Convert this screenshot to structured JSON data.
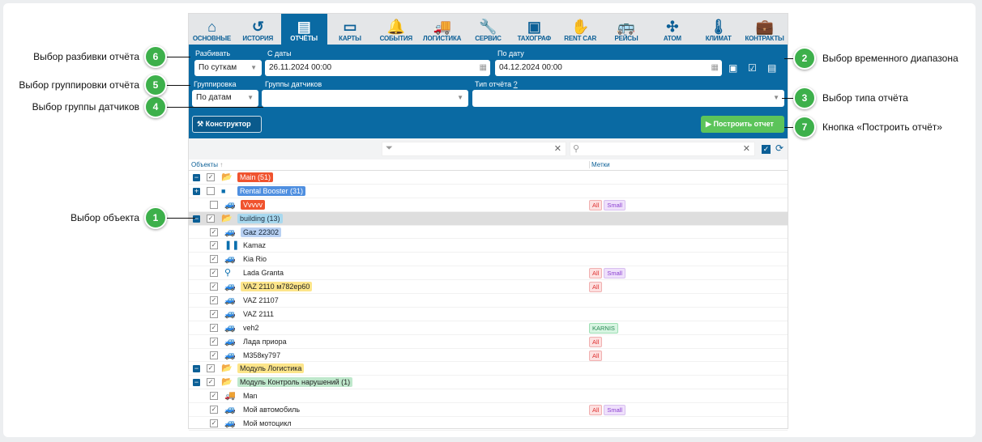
{
  "nav": [
    {
      "label": "ОСНОВНЫЕ",
      "icon": "home-icon",
      "g": "⌂"
    },
    {
      "label": "ИСТОРИЯ",
      "icon": "history-icon",
      "g": "↺"
    },
    {
      "label": "ОТЧЁТЫ",
      "icon": "document-icon",
      "g": "▤",
      "active": true
    },
    {
      "label": "КАРТЫ",
      "icon": "card-icon",
      "g": "▭"
    },
    {
      "label": "СОБЫТИЯ",
      "icon": "bell-icon",
      "g": "🔔"
    },
    {
      "label": "ЛОГИСТИКА",
      "icon": "truck-icon",
      "g": "🚚"
    },
    {
      "label": "СЕРВИС",
      "icon": "wrench-icon",
      "g": "🔧"
    },
    {
      "label": "ТАХОГРАФ",
      "icon": "id-card-icon",
      "g": "▣"
    },
    {
      "label": "RENT CAR",
      "icon": "handshake-icon",
      "g": "✋"
    },
    {
      "label": "РЕЙСЫ",
      "icon": "bus-icon",
      "g": "🚌"
    },
    {
      "label": "ATOM",
      "icon": "network-icon",
      "g": "✣"
    },
    {
      "label": "КЛИМАТ",
      "icon": "thermometer-icon",
      "g": "🌡"
    },
    {
      "label": "КОНТРАКТЫ",
      "icon": "briefcase-icon",
      "g": "💼"
    }
  ],
  "form": {
    "split_label": "Разбивать",
    "split_value": "По суткам",
    "from_label": "С даты",
    "from_value": "26.11.2024 00:00",
    "to_label": "По дату",
    "to_value": "04.12.2024 00:00",
    "group_label": "Группировка",
    "group_value": "По датам",
    "sensors_label": "Группы датчиков",
    "sensors_value": "",
    "type_label": "Тип отчёта",
    "type_help": "?",
    "type_value": "",
    "constructor": "Конструктор",
    "build": "Построить отчет"
  },
  "table": {
    "col_objects": "Объекты",
    "col_tags": "Метки"
  },
  "rows": [
    {
      "level": 0,
      "expand": "−",
      "checked": true,
      "icon": "folder-open-icon",
      "name": "Main (51)",
      "bg": "#f0532e",
      "fg": "#fff"
    },
    {
      "level": 0,
      "expand": "+",
      "checked": false,
      "icon": "folder-icon",
      "name": "Rental Booster (31)",
      "bg": "#4f8fe0",
      "fg": "#fff"
    },
    {
      "level": 1,
      "checked": false,
      "icon": "car-icon",
      "name": "Vvvvv",
      "bg": "#f0532e",
      "fg": "#fff",
      "tags": [
        "All",
        "Small"
      ]
    },
    {
      "level": 0,
      "expand": "−",
      "checked": true,
      "icon": "folder-open-icon",
      "name": "building (13)",
      "bg": "#a8d8ee",
      "fg": "#234",
      "sel": true
    },
    {
      "level": 1,
      "checked": true,
      "icon": "car-icon",
      "name": "Gaz 22302",
      "bg": "#b8d0f2",
      "fg": "#123"
    },
    {
      "level": 1,
      "checked": true,
      "icon": "footprints-icon",
      "name": "Kamaz"
    },
    {
      "level": 1,
      "checked": true,
      "icon": "car-icon",
      "name": "Kia Rio"
    },
    {
      "level": 1,
      "checked": true,
      "icon": "map-pin-icon",
      "name": "Lada Granta",
      "tags": [
        "All",
        "Small"
      ]
    },
    {
      "level": 1,
      "checked": true,
      "icon": "car-icon",
      "name": "VAZ 2110 м782ер60",
      "bg": "#fde58a",
      "fg": "#222",
      "tags": [
        "All"
      ]
    },
    {
      "level": 1,
      "checked": true,
      "icon": "car-icon",
      "name": "VAZ 21107"
    },
    {
      "level": 1,
      "checked": true,
      "icon": "car-icon",
      "name": "VAZ 2111"
    },
    {
      "level": 1,
      "checked": true,
      "icon": "car-icon",
      "name": "veh2",
      "tags": [
        "KARNIS"
      ]
    },
    {
      "level": 1,
      "checked": true,
      "icon": "car-icon",
      "name": "Лада приора",
      "tags": [
        "All"
      ]
    },
    {
      "level": 1,
      "checked": true,
      "icon": "car-icon",
      "name": "М358ку797",
      "tags": [
        "All"
      ]
    },
    {
      "level": 0,
      "expand": "−",
      "checked": true,
      "icon": "folder-open-icon",
      "name": "Модуль Логистика",
      "bg": "#fde58a",
      "fg": "#222"
    },
    {
      "level": 0,
      "expand": "−",
      "checked": true,
      "icon": "folder-open-icon",
      "name": "Модуль Контроль нарушений (1)",
      "bg": "#bfe8cc",
      "fg": "#222"
    },
    {
      "level": 1,
      "checked": true,
      "icon": "truck-icon",
      "name": "Man"
    },
    {
      "level": 1,
      "checked": true,
      "icon": "car-icon",
      "name": "Мой автомобиль",
      "tags": [
        "All",
        "Small"
      ]
    },
    {
      "level": 1,
      "checked": true,
      "icon": "car-icon",
      "name": "Мой мотоцикл"
    }
  ],
  "tag_colors": {
    "All": [
      "#fde0e0",
      "#f0b0b0",
      "#d33"
    ],
    "Small": [
      "#efe0fb",
      "#d8c0f0",
      "#8a3fd0"
    ],
    "KARNIS": [
      "#d8f5e2",
      "#9edfb4",
      "#2a8a55"
    ]
  },
  "callouts": {
    "c1": {
      "n": "1",
      "text": "Выбор объекта"
    },
    "c2": {
      "n": "2",
      "text": "Выбор временного диапазона"
    },
    "c3": {
      "n": "3",
      "text": "Выбор типа отчёта"
    },
    "c4": {
      "n": "4",
      "text": "Выбор группы датчиков"
    },
    "c5": {
      "n": "5",
      "text": "Выбор группировки отчёта"
    },
    "c6": {
      "n": "6",
      "text": "Выбор разбивки отчёта"
    },
    "c7": {
      "n": "7",
      "text": "Кнопка «Построить отчёт»"
    }
  },
  "colors": {
    "primary": "#0a6aa3",
    "build": "#5cc45a",
    "callout": "#3db04b"
  }
}
